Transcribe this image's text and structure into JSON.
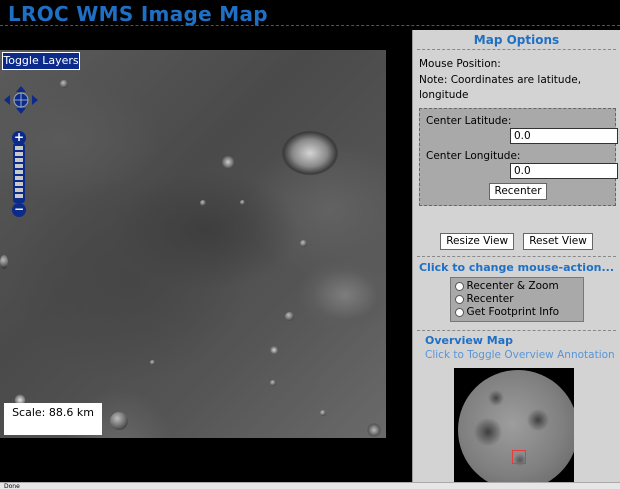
{
  "app": {
    "title": "LROC WMS Image Map"
  },
  "map": {
    "toggle_layers_label": "Toggle Layers",
    "scale_label": "Scale: 88.6 km",
    "zoom_plus": "+",
    "zoom_minus": "−"
  },
  "panel": {
    "title": "Map Options",
    "mouse_position": "Mouse Position:",
    "note": "Note: Coordinates are latitude, longitude",
    "center_latitude_label": "Center Latitude:",
    "center_latitude_value": "0.0",
    "center_longitude_label": "Center Longitude:",
    "center_longitude_value": "0.0",
    "recenter_button": "Recenter",
    "resize_view_button": "Resize View",
    "reset_view_button": "Reset View",
    "mouse_action_title": "Click to change mouse-action...",
    "mouse_actions": [
      {
        "label": "Recenter & Zoom"
      },
      {
        "label": "Recenter"
      },
      {
        "label": "Get Footprint Info"
      }
    ],
    "overview_title": "Overview Map",
    "overview_toggle": "Click to Toggle Overview Annotation"
  },
  "status": {
    "text": "Done"
  },
  "colors": {
    "accent": "#1f6fc4",
    "control_blue": "#0b2a8a",
    "overview_marker": "#e23c3c"
  }
}
